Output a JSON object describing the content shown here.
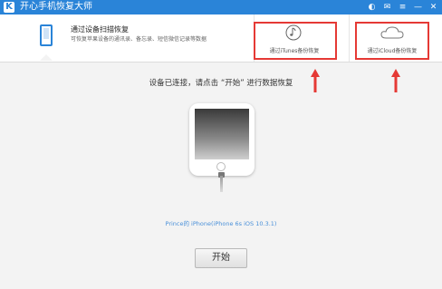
{
  "app": {
    "logo_letter": "K",
    "title": "开心手机恢复大师"
  },
  "window_controls": {
    "wechat": "◐",
    "message": "✉",
    "menu": "≡",
    "minimize": "—",
    "close": "✕"
  },
  "modes": {
    "device_scan": {
      "title": "通过设备扫描恢复",
      "description": "可恢复苹果设备的通讯录、备忘录、短信微信记录等数据"
    },
    "itunes": {
      "label": "通过iTunes备份恢复",
      "icon": "music-note-icon"
    },
    "icloud": {
      "label": "通过iCloud备份恢复",
      "icon": "cloud-icon"
    }
  },
  "main": {
    "status": "设备已连接，请点击 “开始” 进行数据恢复",
    "device_info": "Prince的 iPhone(iPhone 6s iOS 10.3.1)",
    "start_button": "开始"
  },
  "colors": {
    "accent": "#2a84d8",
    "highlight": "#e53935",
    "link": "#4a90d9"
  }
}
